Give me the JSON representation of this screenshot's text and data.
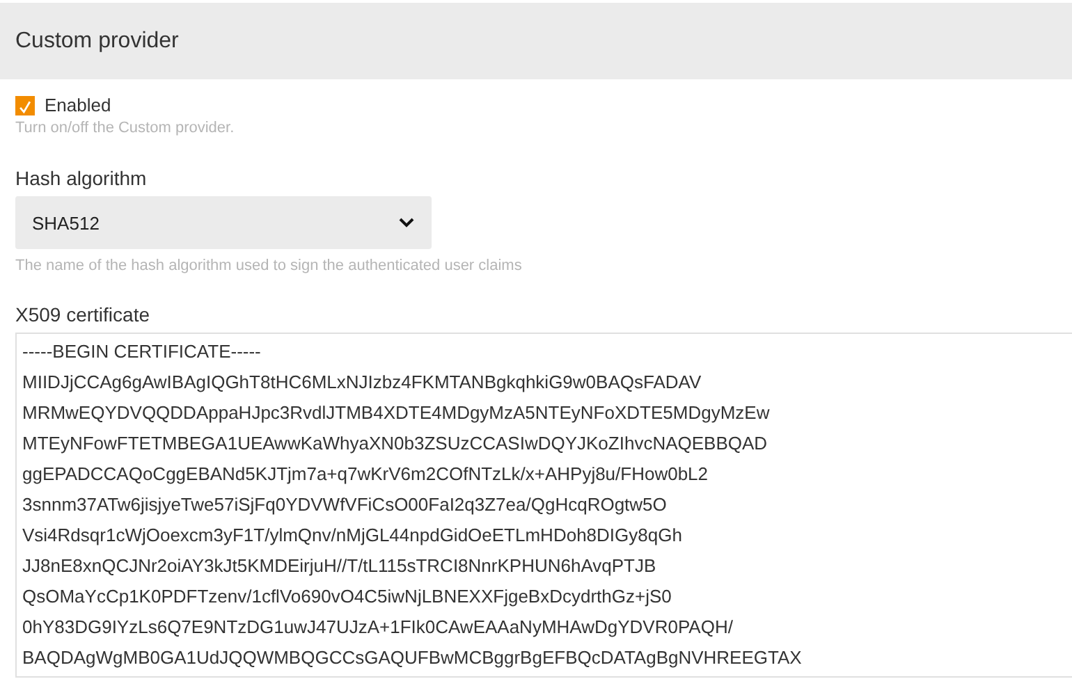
{
  "header": {
    "title": "Custom provider"
  },
  "enabled": {
    "label": "Enabled",
    "checked": true,
    "help": "Turn on/off the Custom provider."
  },
  "hash_algorithm": {
    "label": "Hash algorithm",
    "value": "SHA512",
    "help": "The name of the hash algorithm used to sign the authenticated user claims"
  },
  "certificate": {
    "label": "X509 certificate",
    "lines": [
      "-----BEGIN CERTIFICATE-----",
      "MIIDJjCCAg6gAwIBAgIQGhT8tHC6MLxNJIzbz4FKMTANBgkqhkiG9w0BAQsFADAV",
      "MRMwEQYDVQQDDAppaHJpc3RvdlJTMB4XDTE4MDgyMzA5NTEyNFoXDTE5MDgyMzEw",
      "MTEyNFowFTETMBEGA1UEAwwKaWhyaXN0b3ZSUzCCASIwDQYJKoZIhvcNAQEBBQAD",
      "ggEPADCCAQoCggEBANd5KJTjm7a+q7wKrV6m2COfNTzLk/x+AHPyj8u/FHow0bL2",
      "3snnm37ATw6jisjyeTwe57iSjFq0YDVWfVFiCsO00FaI2q3Z7ea/QgHcqROgtw5O",
      "Vsi4Rdsqr1cWjOoexcm3yF1T/ylmQnv/nMjGL44npdGidOeETLmHDoh8DIGy8qGh",
      "JJ8nE8xnQCJNr2oiAY3kJt5KMDEirjuH//T/tL115sTRCI8NnrKPHUN6hAvqPTJB",
      "QsOMaYcCp1K0PDFTzenv/1cflVo690vO4C5iwNjLBNEXXFjgeBxDcydrthGz+jS0",
      "0hY83DG9IYzLs6Q7E9NTzDG1uwJ47UJzA+1FIk0CAwEAAaNyMHAwDgYDVR0PAQH/",
      "BAQDAgWgMB0GA1UdJQQWMBQGCCsGAQUFBwMCBggrBgEFBQcDATAgBgNVHREEGTAX"
    ]
  }
}
